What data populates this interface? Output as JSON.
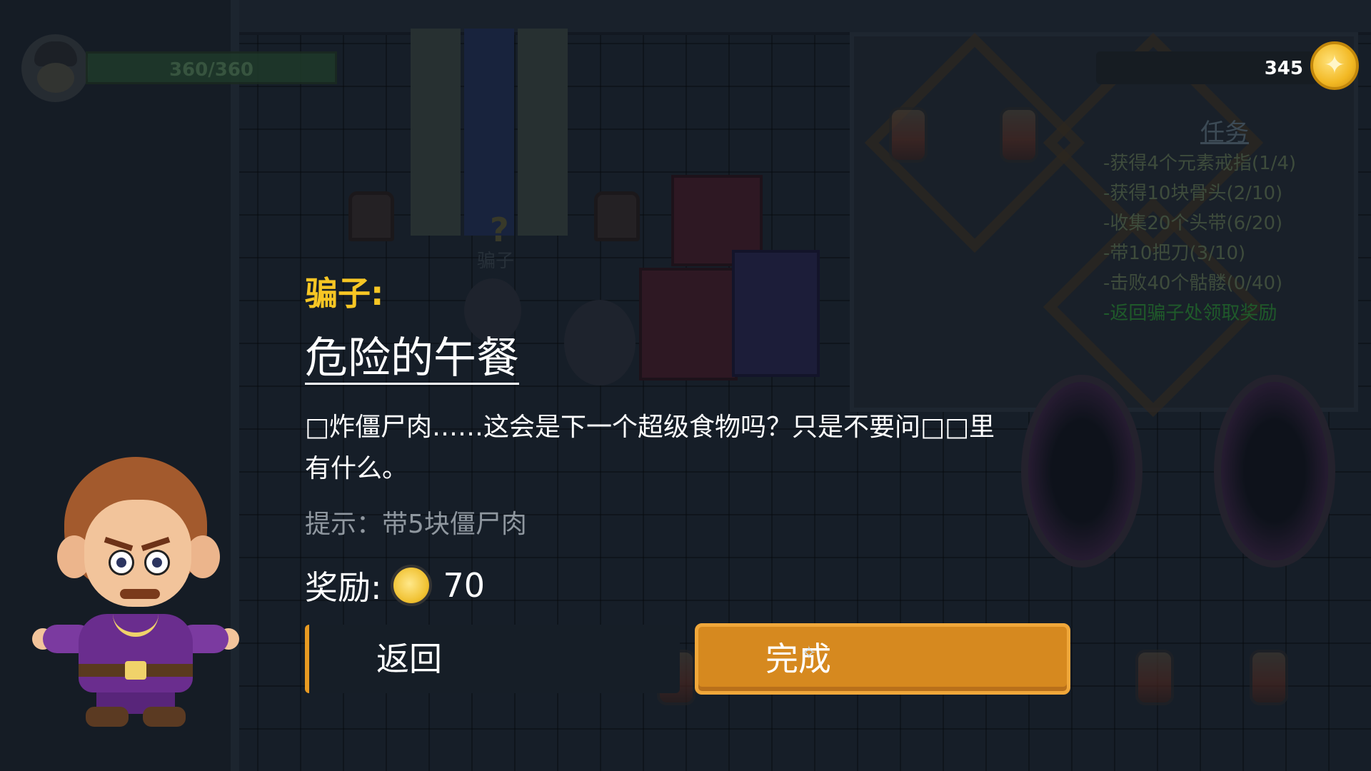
{
  "hud": {
    "hp_text": "360/360",
    "coins": "345"
  },
  "quest_panel": {
    "title": "任务",
    "items": [
      "-获得4个元素戒指(1/4)",
      "-获得10块骨头(2/10)",
      "-收集20个头带(6/20)",
      "-带10把刀(3/10)",
      "-击败40个骷髅(0/40)",
      "-返回骗子处领取奖励"
    ]
  },
  "world": {
    "npc_label": "骗子",
    "npc_marker": "?"
  },
  "dialog": {
    "speaker": "骗子:",
    "quest_name": "危险的午餐",
    "description": "□炸僵尸肉……这会是下一个超级食物吗？只是不要问□□里有什么。",
    "hint": "提示：带5块僵尸肉",
    "reward_label": "奖励:",
    "reward_amount": "70",
    "back_label": "返回",
    "complete_label": "完成"
  },
  "icons": {
    "coin": "coin-icon",
    "star_coin": "star-coin-icon",
    "player_avatar": "player-avatar-icon",
    "npc_portrait": "swindler-portrait"
  },
  "colors": {
    "speaker": "#f7c624",
    "complete_button": "#d6891f",
    "quest_done": "#1f5a2a"
  }
}
